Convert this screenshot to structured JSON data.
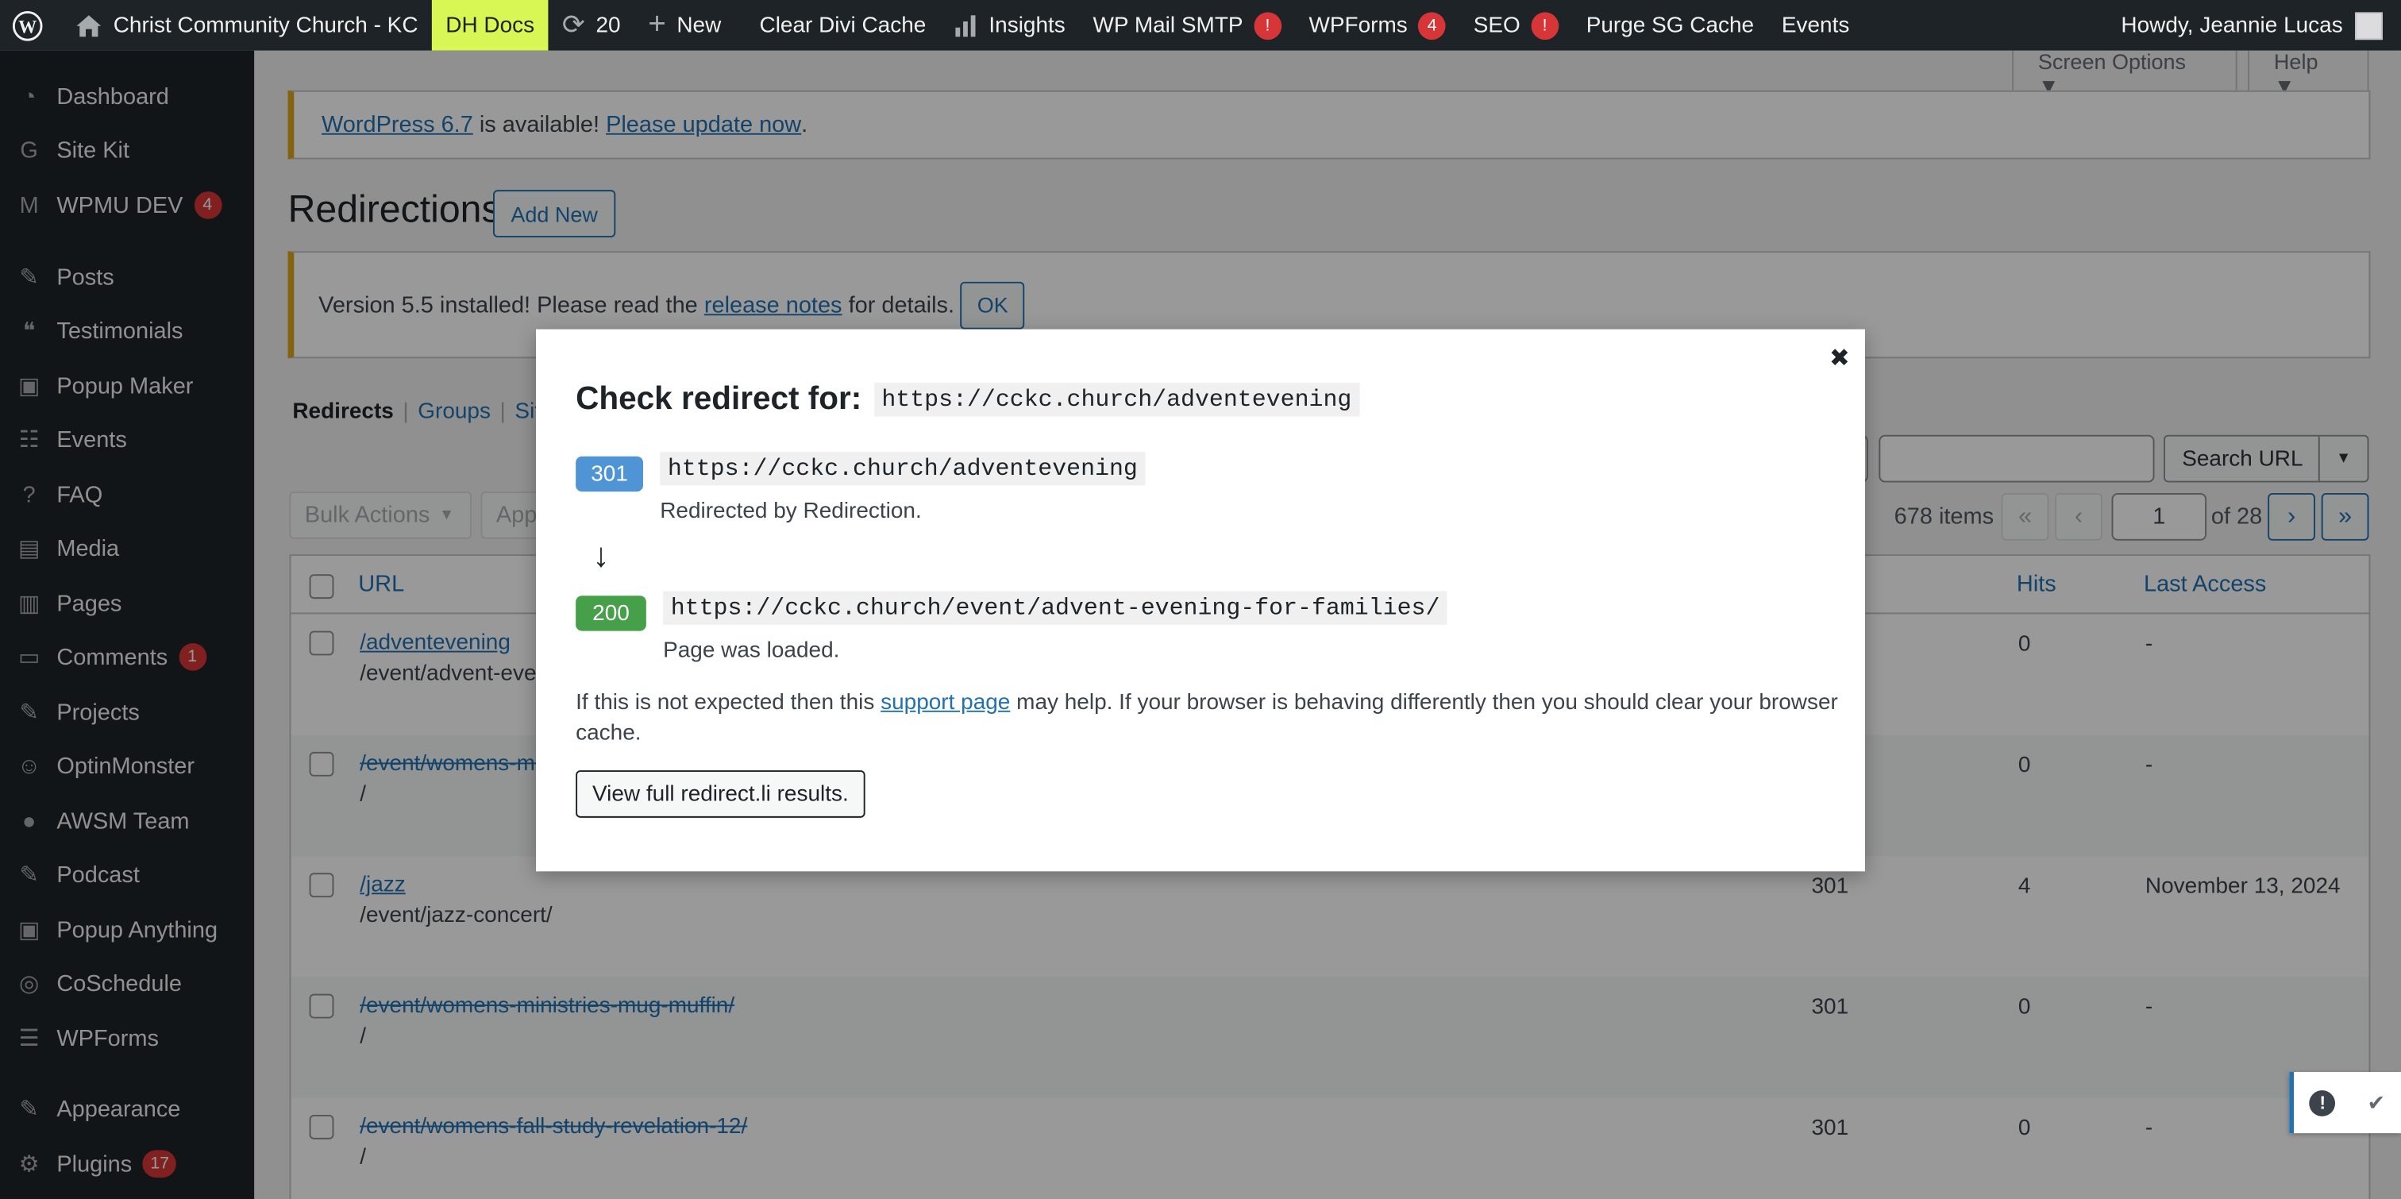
{
  "adminbar": {
    "site_name": "Christ Community Church - KC",
    "dh_docs": "DH Docs",
    "updates_count": "20",
    "new_label": "New",
    "clear_divi": "Clear Divi Cache",
    "insights": "Insights",
    "wp_mail": "WP Mail SMTP",
    "wp_mail_badge": "!",
    "wpforms": "WPForms",
    "wpforms_badge": "4",
    "seo": "SEO",
    "seo_badge": "!",
    "purge": "Purge SG Cache",
    "events": "Events",
    "howdy": "Howdy, Jeannie Lucas"
  },
  "sidebar": {
    "items": [
      {
        "label": "Dashboard",
        "icon": "dashboard-icon"
      },
      {
        "label": "Site Kit",
        "icon": "google-icon"
      },
      {
        "label": "WPMU DEV",
        "icon": "wpmudev-icon",
        "badge": "4"
      },
      {
        "label": "Posts",
        "icon": "pin-icon"
      },
      {
        "label": "Testimonials",
        "icon": "testimonials-icon"
      },
      {
        "label": "Popup Maker",
        "icon": "popup-icon"
      },
      {
        "label": "Events",
        "icon": "events-icon"
      },
      {
        "label": "FAQ",
        "icon": "help-icon"
      },
      {
        "label": "Media",
        "icon": "media-icon"
      },
      {
        "label": "Pages",
        "icon": "pages-icon"
      },
      {
        "label": "Comments",
        "icon": "comments-icon",
        "badge": "1"
      },
      {
        "label": "Projects",
        "icon": "pin-icon"
      },
      {
        "label": "OptinMonster",
        "icon": "optinmonster-icon"
      },
      {
        "label": "AWSM Team",
        "icon": "user-icon"
      },
      {
        "label": "Podcast",
        "icon": "pin-icon"
      },
      {
        "label": "Popup Anything",
        "icon": "popup-icon"
      },
      {
        "label": "CoSchedule",
        "icon": "coschedule-icon"
      },
      {
        "label": "WPForms",
        "icon": "forms-icon"
      },
      {
        "label": "Appearance",
        "icon": "brush-icon"
      },
      {
        "label": "Plugins",
        "icon": "plugin-icon",
        "badge": "17"
      }
    ]
  },
  "top": {
    "screen_options": "Screen Options ▼",
    "help": "Help ▼"
  },
  "update_notice": {
    "link1": "WordPress 6.7",
    "text": "is available!",
    "link2": "Please update now",
    "end": "."
  },
  "page": {
    "title": "Redirections",
    "add_new": "Add New"
  },
  "version_notice": {
    "text1": "Version 5.5 installed! Please read the",
    "link": "release notes",
    "text2": "for details.",
    "ok": "OK"
  },
  "subsub": {
    "current": "Redirects",
    "groups": "Groups",
    "site": "Sit"
  },
  "toolbar": {
    "bulk_actions": "Bulk Actions",
    "apply": "App",
    "search_button": "Search URL",
    "items_count": "678 items",
    "first": "«",
    "prev": "‹",
    "page": "1",
    "of": "of 28",
    "next": "›",
    "last": "»"
  },
  "table": {
    "headers": {
      "url": "URL",
      "hits": "Hits",
      "last_access": "Last Access"
    },
    "rows": [
      {
        "source": "/adventevening",
        "target": "/event/advent-evening-for-families/",
        "code": "",
        "hits": "0",
        "last": "-",
        "disabled": false
      },
      {
        "source": "/event/womens-ministries-mug-muffin/",
        "target": "/",
        "code": "",
        "hits": "0",
        "last": "-",
        "disabled": true
      },
      {
        "source": "/jazz",
        "target": "/event/jazz-concert/",
        "code": "301",
        "hits": "4",
        "last": "November 13, 2024",
        "disabled": false
      },
      {
        "source": "/event/womens-ministries-mug-muffin/",
        "target": "/",
        "code": "301",
        "hits": "0",
        "last": "-",
        "disabled": true
      },
      {
        "source": "/event/womens-fall-study-revelation-12/",
        "target": "/",
        "code": "301",
        "hits": "0",
        "last": "-",
        "disabled": true
      }
    ]
  },
  "modal": {
    "title": "Check redirect for:",
    "title_url": "https://cckc.church/adventevening",
    "close": "✖",
    "step1": {
      "code": "301",
      "url": "https://cckc.church/adventevening",
      "desc": "Redirected by Redirection.",
      "color": "#4f94d4"
    },
    "arrow": "↓",
    "step2": {
      "code": "200",
      "url": "https://cckc.church/event/advent-evening-for-families/",
      "desc": "Page was loaded.",
      "color": "#46a049"
    },
    "help_text1": "If this is not expected then this",
    "help_link": "support page",
    "help_text2": "may help. If your browser is behaving differently then you should clear your browser cache.",
    "full_results": "View full redirect.li results."
  },
  "colors": {
    "adminbar_bg": "#1d2327",
    "highlight": "#d9f754",
    "link": "#2271b1",
    "badge": "#d63638"
  }
}
